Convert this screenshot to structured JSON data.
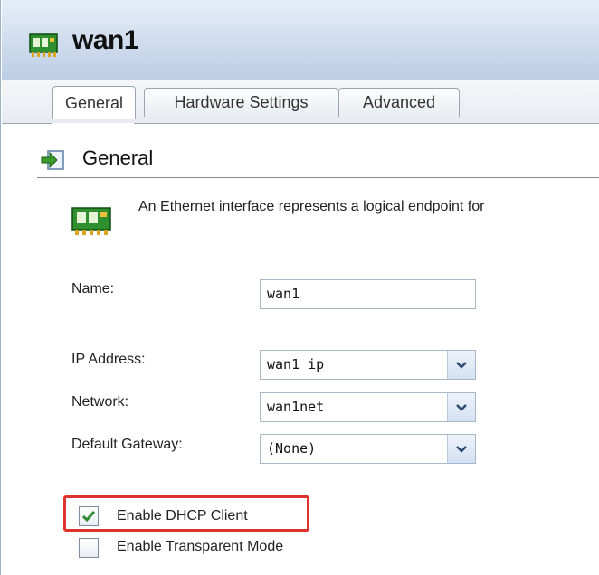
{
  "window": {
    "title": "wan1"
  },
  "tabs": [
    {
      "label": "General",
      "active": true
    },
    {
      "label": "Hardware Settings",
      "active": false
    },
    {
      "label": "Advanced",
      "active": false
    }
  ],
  "section": {
    "title": "General"
  },
  "description": "An Ethernet interface represents a logical endpoint for",
  "form": {
    "name": {
      "label": "Name:",
      "value": "wan1"
    },
    "ip_address": {
      "label": "IP Address:",
      "value": "wan1_ip"
    },
    "network": {
      "label": "Network:",
      "value": "wan1net"
    },
    "default_gateway": {
      "label": "Default Gateway:",
      "value": "(None)"
    }
  },
  "options": {
    "dhcp": {
      "label": "Enable DHCP Client",
      "checked": true
    },
    "transparent": {
      "label": "Enable Transparent Mode",
      "checked": false
    }
  },
  "colors": {
    "highlight": "#e0322e",
    "title_bg": "#cfdcee",
    "check": "#2e8b2e"
  }
}
